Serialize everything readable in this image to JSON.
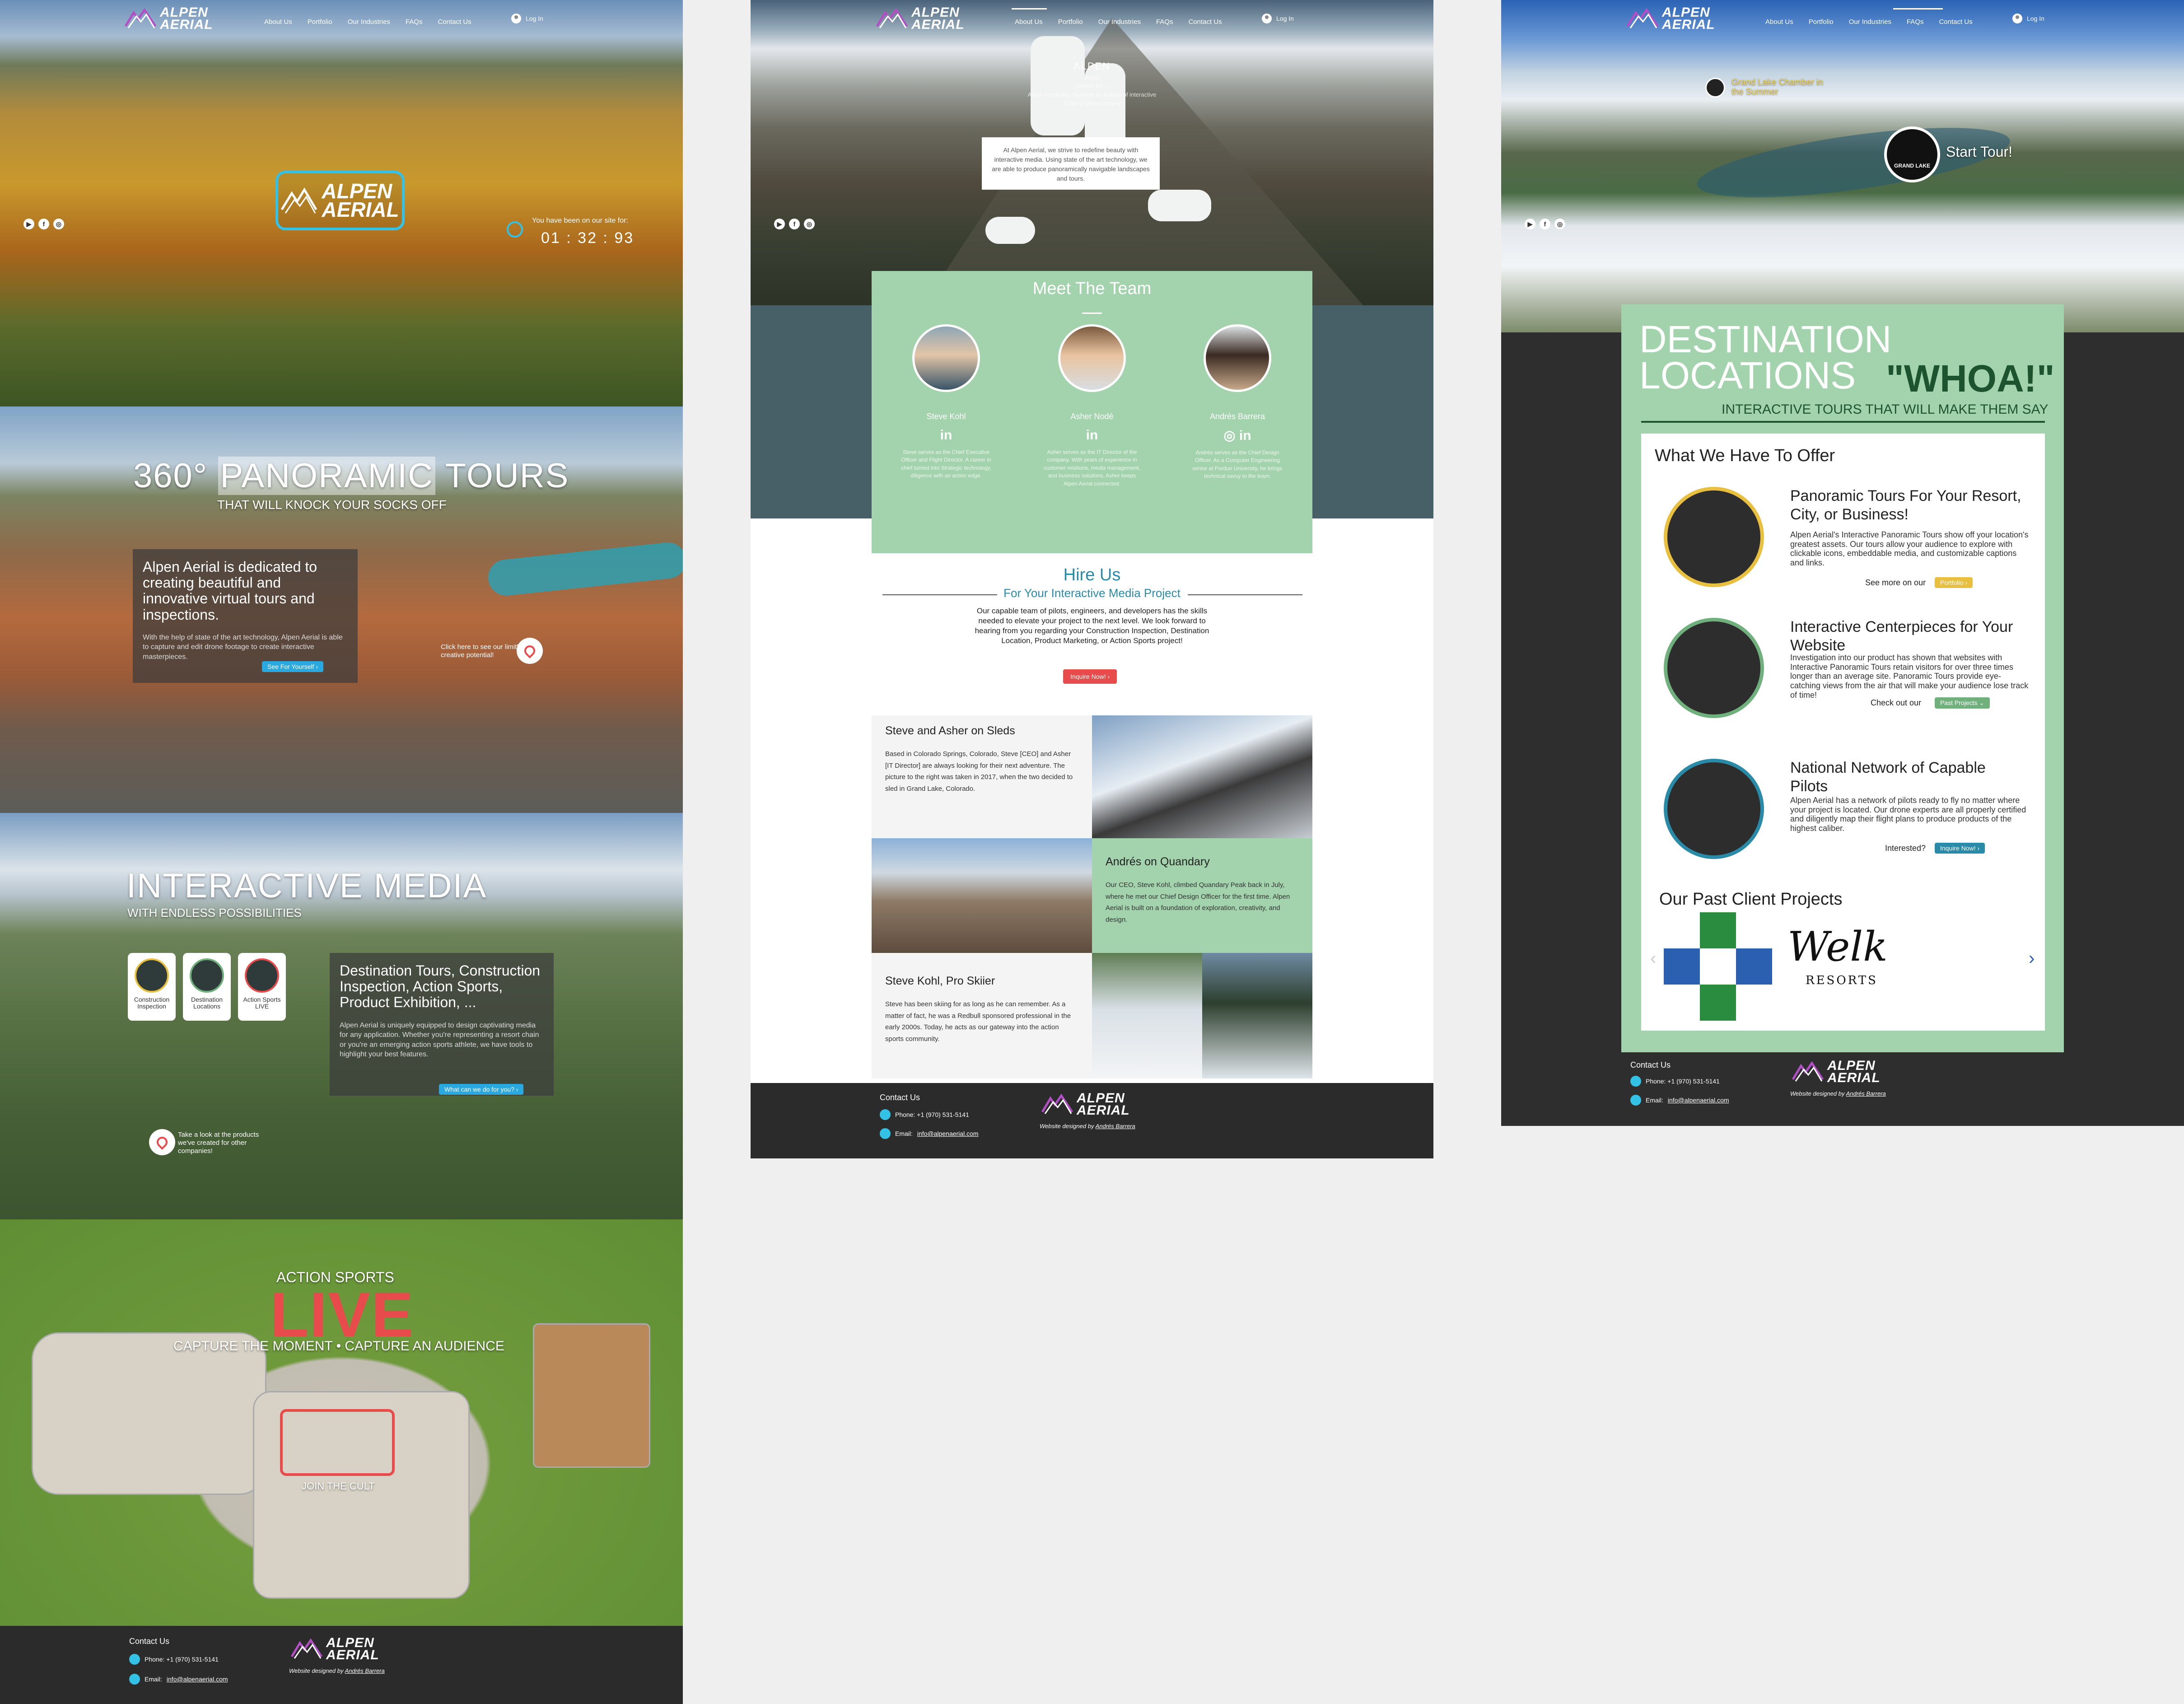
{
  "brand": {
    "logo_line1": "ALPEN",
    "logo_line2": "AERIAL"
  },
  "nav": {
    "items": [
      "About Us",
      "Portfolio",
      "Our Industries",
      "FAQs",
      "Contact Us"
    ],
    "login": "Log In"
  },
  "social": [
    "▶",
    "f",
    "◎"
  ],
  "home": {
    "timer_label": "You have been on our site for:",
    "timer_value": "01 : 32 : 93",
    "pano_title_1": "360°",
    "pano_title_2": "PANORAMIC",
    "pano_title_3": "TOURS",
    "pano_subtitle": "THAT WILL KNOCK YOUR SOCKS OFF",
    "pano_card_title": "Alpen Aerial is dedicated to creating beautiful and innovative virtual tours and inspections.",
    "pano_card_text": "With the help of state of the art technology, Alpen Aerial is able to capture and edit drone footage to create interactive masterpieces.",
    "pano_card_button": "See For Yourself ›",
    "pano_pin_note": "Click here to see our limitless creative potential!",
    "inter_title": "INTERACTIVE MEDIA",
    "inter_subtitle": "WITH ENDLESS POSSIBILITIES",
    "badges": [
      "Construction Inspection",
      "Destination Locations",
      "Action Sports LIVE"
    ],
    "inter_card_title": "Destination Tours, Construction Inspection, Action Sports, Product Exhibition, ...",
    "inter_card_text": "Alpen Aerial is uniquely equipped to design captivating media for any application. Whether you're representing a resort chain or you're an emerging action sports athlete, we have tools to highlight your best features.",
    "inter_card_button": "What can we do for you? ›",
    "inter_pin_note": "Take a look at the products we've created for other companies!",
    "action_label": "ACTION SPORTS",
    "action_live": "LIVE",
    "action_subtitle": "CAPTURE THE MOMENT • CAPTURE AN AUDIENCE",
    "action_cta": "JOIN THE CULT"
  },
  "footer": {
    "contact_title": "Contact Us",
    "phone": "Phone: +1 (970) 531-5141",
    "email_label": "Email:",
    "email": "info@alpenaerial.com",
    "designed_by_prefix": "Website designed by",
    "designer": "Andrés Barrera"
  },
  "about": {
    "hero_title": "ALPEN",
    "hero_lines": [
      "Aerial",
      "Denver for ...",
      "Alpen Aerial was founded as a team of interactive",
      "To be of global beauty"
    ],
    "intro": "At Alpen Aerial, we strive to redefine beauty with interactive media. Using state of the art technology, we are able to produce panoramically navigable landscapes and tours.",
    "team_title": "Meet The Team",
    "team": [
      {
        "name": "Steve Kohl",
        "bio": "Steve serves as the Chief Executive Officer and Flight Director. A career in chief turned into Strategic technology, diligence with an action edge."
      },
      {
        "name": "Asher Nodé",
        "bio": "Asher serves as the IT Director of the company. With years of experience in customer relations, media management, and business solutions, Asher keeps Alpen Aerial connected."
      },
      {
        "name": "Andrés Barrera",
        "bio": "Andrés serves as the Chief Design Officer. As a Computer Engineering senior at Purdue University, he brings technical savvy to the team."
      }
    ],
    "linkedin": "in",
    "instagram": "◎",
    "hire_title": "Hire Us",
    "hire_subtitle": "For Your Interactive Media Project",
    "hire_text": "Our capable team of pilots, engineers, and developers has the skills needed to elevate your project to the next level. We look forward to hearing from you regarding your Construction Inspection, Destination Location, Product Marketing, or Action Sports project!",
    "hire_button": "Inquire Now! ›",
    "stories": [
      {
        "title": "Steve and Asher on Sleds",
        "text": "Based in Colorado Springs, Colorado, Steve [CEO] and Asher [IT Director] are always looking for their next adventure. The picture to the right was taken in 2017, when the two decided to sled in Grand Lake, Colorado."
      },
      {
        "title": "Andrés on Quandary",
        "text": "Our CEO, Steve Kohl, climbed Quandary Peak back in July, where he met our Chief Design Officer for the first time. Alpen Aerial is built on a foundation of exploration, creativity, and design."
      },
      {
        "title": "Steve Kohl, Pro Skiier",
        "text": "Steve has been skiing for as long as he can remember. As a matter of fact, he was a Redbull sponsored professional in the early 2000s. Today, he acts as our gateway into the action sports community."
      }
    ]
  },
  "industries": {
    "tour_badge": "Grand Lake Chamber in the Summer",
    "start_tour": "Start Tour!",
    "grand_lake": "GRAND LAKE",
    "dest_line1": "DESTINATION",
    "dest_line2": "LOCATIONS",
    "whoa": "\"WHOA!\"",
    "tagline": "INTERACTIVE TOURS THAT WILL MAKE THEM SAY",
    "offer_title": "What We Have To Offer",
    "services": [
      {
        "title": "Panoramic Tours For Your Resort, City, or Business!",
        "text": "Alpen Aerial's Interactive Panoramic Tours show off your location's greatest assets. Our tours allow your audience to explore with clickable icons, embeddable media, and customizable captions and links.",
        "cta": "See more on our",
        "button": "Portfolio ›",
        "accent": "#e8bf3e"
      },
      {
        "title": "Interactive Centerpieces for Your Website",
        "text": "Investigation into our product has shown that websites with Interactive Panoramic Tours retain visitors for over three times longer than an average site. Panoramic Tours provide eye-catching views from the air that will make your audience lose track of time!",
        "cta": "Check out our",
        "button": "Past Projects ⌄",
        "accent": "#6fb07d"
      },
      {
        "title": "National Network of Capable Pilots",
        "text": "Alpen Aerial has a network of pilots ready to fly no matter where your project is located. Our drone experts are all properly certified and diligently map their flight plans to produce products of the highest caliber.",
        "cta": "Interested?",
        "button": "Inquire Now! ›",
        "accent": "#2a8ba8"
      }
    ],
    "clients_title": "Our Past Client Projects",
    "client_welk": "Welk",
    "client_resorts": "RESORTS",
    "prev": "‹",
    "next": "›"
  }
}
